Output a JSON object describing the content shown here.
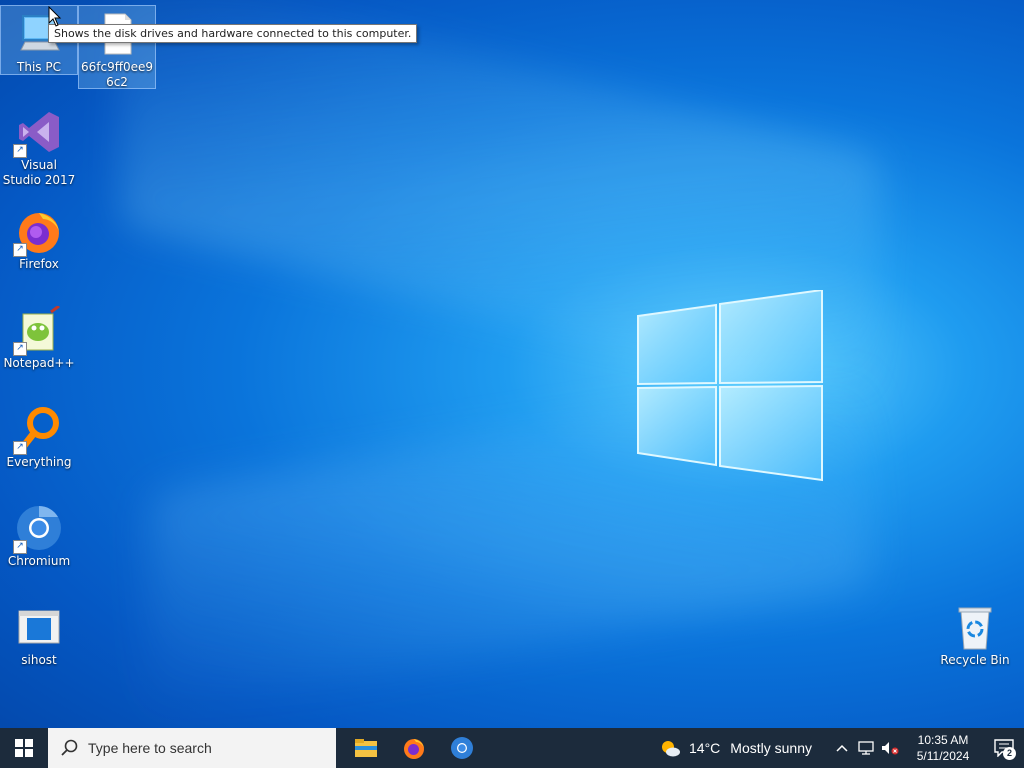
{
  "desktop": {
    "tooltip": "Shows the disk drives and hardware connected to this computer.",
    "icons": [
      {
        "label": "This PC",
        "icon": "this-pc-icon"
      },
      {
        "label": "66fc9ff0ee96c2",
        "icon": "file-icon"
      },
      {
        "label": "Visual Studio 2017",
        "icon": "visual-studio-icon"
      },
      {
        "label": "Firefox",
        "icon": "firefox-icon"
      },
      {
        "label": "Notepad++",
        "icon": "notepad-plus-plus-icon"
      },
      {
        "label": "Everything",
        "icon": "everything-search-icon"
      },
      {
        "label": "Chromium",
        "icon": "chromium-icon"
      },
      {
        "label": "sihost",
        "icon": "sihost-app-icon"
      },
      {
        "label": "Recycle Bin",
        "icon": "recycle-bin-icon"
      }
    ]
  },
  "taskbar": {
    "search_placeholder": "Type here to search",
    "pinned": [
      "file-explorer-icon",
      "firefox-icon",
      "chromium-icon"
    ],
    "weather": {
      "temp": "14°C",
      "condition": "Mostly sunny"
    },
    "clock": {
      "time": "10:35 AM",
      "date": "5/11/2024"
    },
    "notification_count": "2"
  },
  "colors": {
    "taskbar_bg": "#1c2b3c",
    "desktop_accent": "#0a74db"
  }
}
